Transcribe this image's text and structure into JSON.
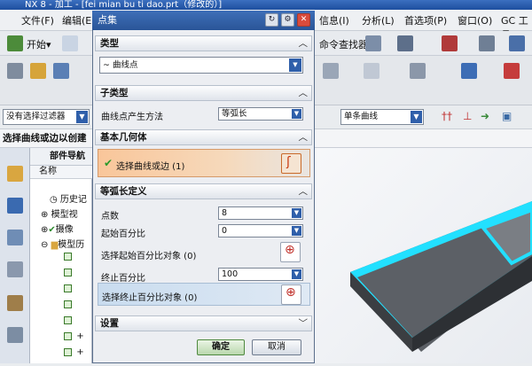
{
  "window": {
    "title": "NX 8 - 加工 - [fei mian bu ti dao.prt（修改的）]"
  },
  "menubar": {
    "left_items": [
      "文件(F)",
      "编辑(E)"
    ],
    "right_items": [
      "信息(I)",
      "分析(L)",
      "首选项(P)",
      "窗口(O)",
      "GC 工具"
    ]
  },
  "toolbar": {
    "start_label": "开始▾",
    "command_finder_label": "命令查找器"
  },
  "filterbar": {
    "filter_value": "没有选择过滤器",
    "curve_rule_value": "单条曲线"
  },
  "cue_line": {
    "text": "选择曲线或边以创建"
  },
  "navigator": {
    "title": "部件导航",
    "column_name": "名称",
    "rows": [
      "历史记",
      "模型视",
      "摄像",
      "模型历"
    ]
  },
  "dialog": {
    "title": "点集",
    "type_section": {
      "title": "类型",
      "selected": "曲线点"
    },
    "subtype_section": {
      "title": "子类型",
      "method_label": "曲线点产生方法",
      "method_value": "等弧长"
    },
    "base_geometry": {
      "title": "基本几何体",
      "select_label": "选择曲线或边 (1)"
    },
    "arc_length": {
      "title": "等弧长定义",
      "point_count_label": "点数",
      "point_count_value": "8",
      "start_pct_label": "起始百分比",
      "start_pct_value": "0",
      "start_obj_label": "选择起始百分比对象 (0)",
      "end_pct_label": "终止百分比",
      "end_pct_value": "100",
      "end_obj_label": "选择终止百分比对象 (0)"
    },
    "settings": {
      "title": "设置"
    },
    "ok_label": "确定",
    "cancel_label": "取消"
  }
}
